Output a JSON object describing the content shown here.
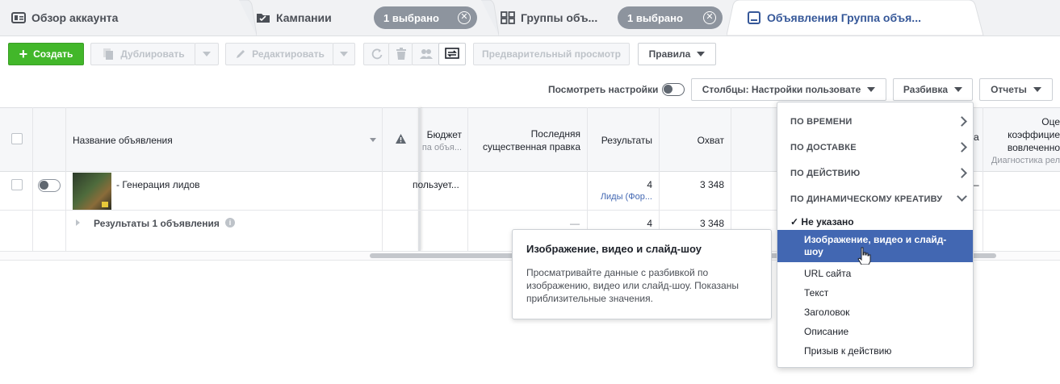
{
  "tabs": [
    {
      "label": "Обзор аккаунта",
      "icon": "account-overview-icon"
    },
    {
      "label": "Кампании",
      "icon": "folder-icon",
      "selection": "1 выбрано"
    },
    {
      "label": "Группы объ...",
      "icon": "grid-icon",
      "selection": "1 выбрано"
    },
    {
      "label": "Объявления Группа объя...",
      "icon": "ad-icon",
      "active": true
    }
  ],
  "toolbar": {
    "create": "Создать",
    "duplicate": "Дублировать",
    "edit": "Редактировать",
    "preview": "Предварительный просмотр",
    "rules": "Правила"
  },
  "view_bar": {
    "view_settings": "Посмотреть настройки",
    "columns": "Столбцы: Настройки пользовате",
    "breakdown": "Разбивка",
    "reports": "Отчеты"
  },
  "table": {
    "headers": {
      "name": "Название объявления",
      "budget": "Бюджет",
      "budget_sub": "па объя...",
      "last_edit_1": "Последняя",
      "last_edit_2": "существенная правка",
      "results": "Результаты",
      "reach": "Охват",
      "hidden_1": "Оце",
      "hidden_2": "коэффицие",
      "hidden_3": "вовлеченно",
      "hidden_sub": "Диагностика рел",
      "hidden_a": "а"
    },
    "row": {
      "name": "- Генерация лидов",
      "budget": "пользует...",
      "results": "4",
      "results_sub": "Лиды (Фор...",
      "reach": "3 348",
      "dash": "–"
    },
    "summary": {
      "label": "Результаты 1 объявления",
      "last_edit": "—",
      "results": "4",
      "reach": "3 348"
    }
  },
  "tooltip": {
    "title": "Изображение, видео и слайд-шоу",
    "body": "Просматривайте данные с разбивкой по изображению, видео или слайд-шоу. Показаны приблизительные значения."
  },
  "breakdown_menu": {
    "categories": [
      {
        "label": "ПО ВРЕМЕНИ"
      },
      {
        "label": "ПО ДОСТАВКЕ"
      },
      {
        "label": "ПО ДЕЙСТВИЮ"
      },
      {
        "label": "ПО ДИНАМИЧЕСКОМУ КРЕАТИВУ"
      }
    ],
    "checked_item": "Не указано",
    "highlighted_item": "Изображение, видео и слайд-шоу",
    "items": [
      "URL сайта",
      "Текст",
      "Заголовок",
      "Описание",
      "Призыв к действию"
    ]
  },
  "colors": {
    "accent": "#4267b2",
    "create_button": "#42b72a",
    "selection_pill": "#8d949e"
  }
}
